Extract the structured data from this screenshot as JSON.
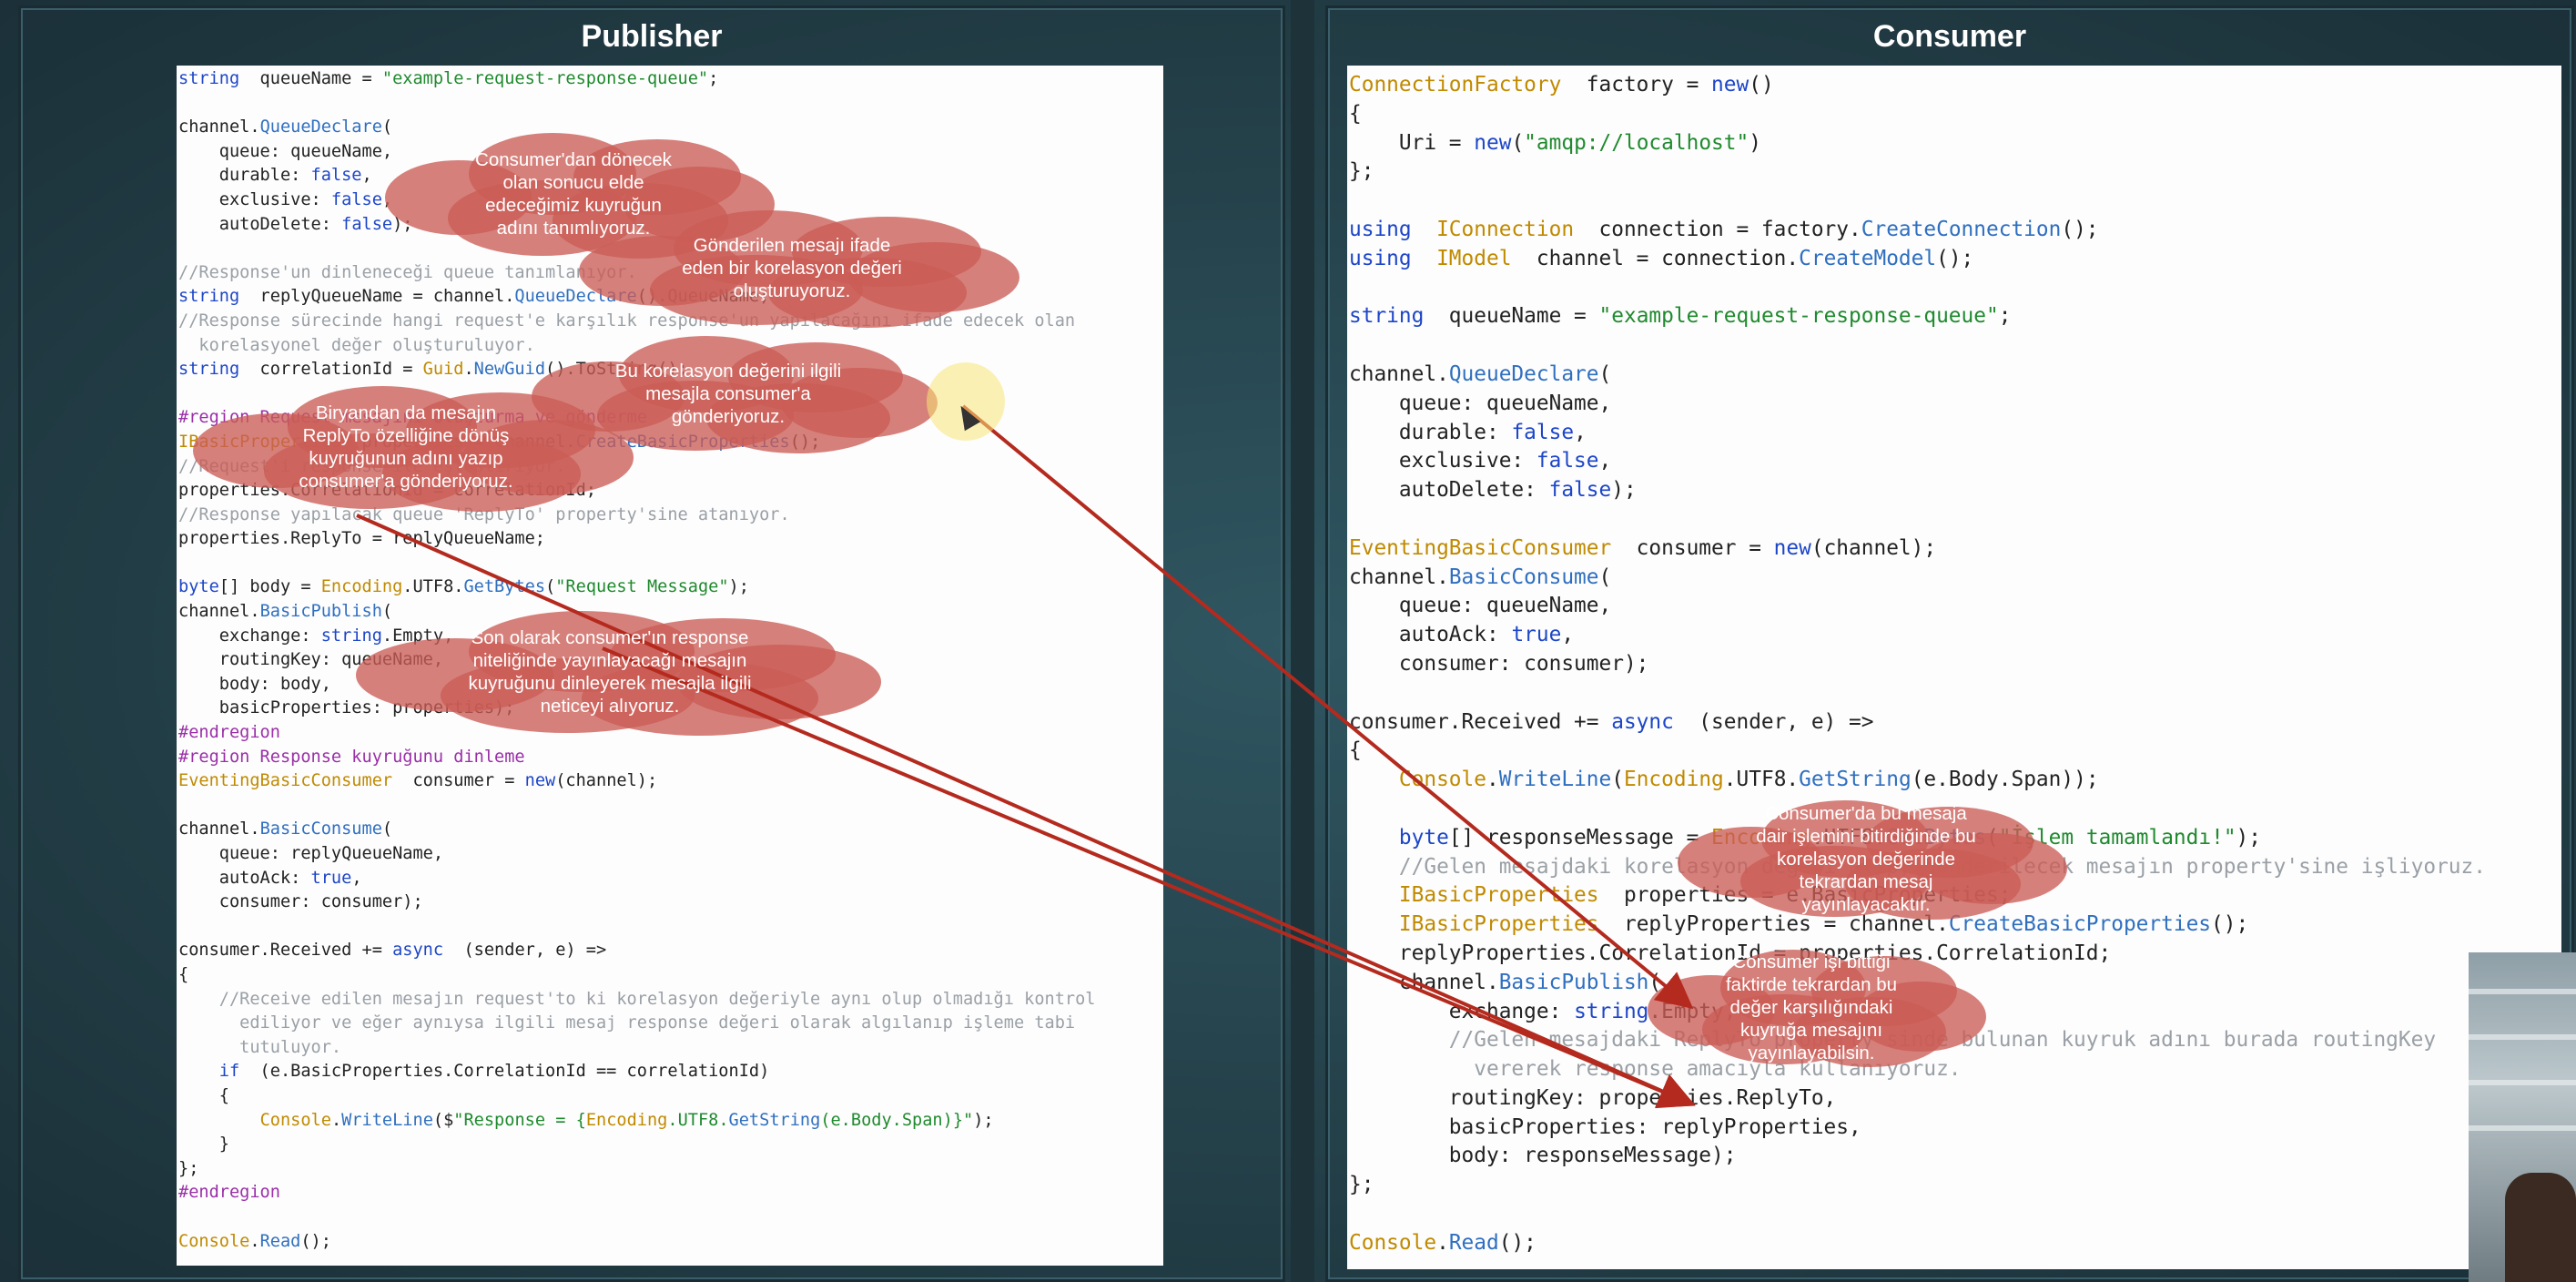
{
  "titles": {
    "publisher": "Publisher",
    "consumer": "Consumer"
  },
  "publisher_code": [
    [
      [
        "kw",
        "string"
      ],
      [
        "",
        "  queueName = "
      ],
      [
        "st",
        "\"example-request-response-queue\""
      ],
      [
        "",
        ";"
      ]
    ],
    [],
    [
      [
        "",
        "channel."
      ],
      [
        "mt",
        "QueueDeclare"
      ],
      [
        "",
        "("
      ]
    ],
    [
      [
        "",
        "    queue: queueName,"
      ]
    ],
    [
      [
        "",
        "    durable: "
      ],
      [
        "kw",
        "false"
      ],
      [
        "",
        ","
      ]
    ],
    [
      [
        "",
        "    exclusive: "
      ],
      [
        "kw",
        "false"
      ],
      [
        "",
        ","
      ]
    ],
    [
      [
        "",
        "    autoDelete: "
      ],
      [
        "kw",
        "false"
      ],
      [
        "",
        ");"
      ]
    ],
    [],
    [
      [
        "cm",
        "//Response'un dinleneceği queue tanımlanıyor."
      ]
    ],
    [
      [
        "kw",
        "string"
      ],
      [
        "",
        ""
      ],
      [
        "",
        "  replyQueueName = channel."
      ],
      [
        "mt",
        "QueueDeclare"
      ],
      [
        "",
        "().QueueName;"
      ]
    ],
    [
      [
        "cm",
        "//Response sürecinde hangi request'e karşılık response'un yapılacağını ifade edecek olan"
      ]
    ],
    [
      [
        "cm",
        "  korelasyonel değer oluşturuluyor."
      ]
    ],
    [
      [
        "kw",
        "string"
      ],
      [
        "",
        "  correlationId = "
      ],
      [
        "ty",
        "Guid"
      ],
      [
        "",
        "."
      ],
      [
        "mt",
        "NewGuid"
      ],
      [
        "",
        "().ToString();"
      ]
    ],
    [],
    [
      [
        "rg",
        "#region Request mesajını oluşturma ve gönderme"
      ]
    ],
    [
      [
        "ty",
        "IBasicProperties"
      ],
      [
        "",
        "  properties = channel."
      ],
      [
        "mt",
        "CreateBasicProperties"
      ],
      [
        "",
        "();"
      ]
    ],
    [
      [
        "cm",
        "//Request'i response ile eşleştiriyor."
      ]
    ],
    [
      [
        "",
        "properties.CorrelationId = correlationId;"
      ]
    ],
    [
      [
        "cm",
        "//Response yapılacak queue 'ReplyTo' property'sine atanıyor."
      ]
    ],
    [
      [
        "",
        "properties.ReplyTo = replyQueueName;"
      ]
    ],
    [],
    [
      [
        "kw",
        "byte"
      ],
      [
        "",
        "[] body = "
      ],
      [
        "ty",
        "Encoding"
      ],
      [
        "",
        ".UTF8."
      ],
      [
        "mt",
        "GetBytes"
      ],
      [
        "",
        "("
      ],
      [
        "st",
        "\"Request Message\""
      ],
      [
        "",
        ");"
      ]
    ],
    [
      [
        "",
        "channel."
      ],
      [
        "mt",
        "BasicPublish"
      ],
      [
        "",
        "("
      ]
    ],
    [
      [
        "",
        "    exchange: "
      ],
      [
        "kw",
        "string"
      ],
      [
        "",
        ".Empty,"
      ]
    ],
    [
      [
        "",
        "    routingKey: queueName,"
      ]
    ],
    [
      [
        "",
        "    body: body,"
      ]
    ],
    [
      [
        "",
        "    basicProperties: properties);"
      ]
    ],
    [
      [
        "rg",
        "#endregion"
      ]
    ],
    [
      [
        "rg",
        "#region Response kuyruğunu dinleme"
      ]
    ],
    [
      [
        "ty",
        "EventingBasicConsumer"
      ],
      [
        "",
        "  consumer = "
      ],
      [
        "kw",
        "new"
      ],
      [
        "",
        "(channel);"
      ]
    ],
    [],
    [
      [
        "",
        "channel."
      ],
      [
        "mt",
        "BasicConsume"
      ],
      [
        "",
        "("
      ]
    ],
    [
      [
        "",
        "    queue: replyQueueName,"
      ]
    ],
    [
      [
        "",
        "    autoAck: "
      ],
      [
        "kw",
        "true"
      ],
      [
        "",
        ","
      ]
    ],
    [
      [
        "",
        "    consumer: consumer);"
      ]
    ],
    [],
    [
      [
        "",
        "consumer.Received += "
      ],
      [
        "kw",
        "async"
      ],
      [
        "",
        "  (sender, e) =>"
      ]
    ],
    [
      [
        "",
        "{"
      ]
    ],
    [
      [
        "cm",
        "    //Receive edilen mesajın request'to ki korelasyon değeriyle aynı olup olmadığı kontrol"
      ]
    ],
    [
      [
        "cm",
        "      ediliyor ve eğer aynıysa ilgili mesaj response değeri olarak algılanıp işleme tabi"
      ]
    ],
    [
      [
        "cm",
        "      tutuluyor."
      ]
    ],
    [
      [
        "",
        "    "
      ],
      [
        "kw",
        "if"
      ],
      [
        "",
        "  (e.BasicProperties.CorrelationId == correlationId)"
      ]
    ],
    [
      [
        "",
        "    {"
      ]
    ],
    [
      [
        "",
        "        "
      ],
      [
        "ty",
        "Console"
      ],
      [
        "",
        "."
      ],
      [
        "mt",
        "WriteLine"
      ],
      [
        "",
        "($"
      ],
      [
        "st",
        "\"Response = {"
      ],
      [
        "ty",
        "Encoding"
      ],
      [
        "st",
        ".UTF8."
      ],
      [
        "mt",
        "GetString"
      ],
      [
        "st",
        "(e.Body.Span)}\""
      ],
      [
        "",
        ");"
      ]
    ],
    [
      [
        "",
        "    }"
      ]
    ],
    [
      [
        "",
        "};"
      ]
    ],
    [
      [
        "rg",
        "#endregion"
      ]
    ],
    [],
    [
      [
        "ty",
        "Console"
      ],
      [
        "",
        "."
      ],
      [
        "mt",
        "Read"
      ],
      [
        "",
        "();"
      ]
    ]
  ],
  "consumer_code": [
    [
      [
        "ty",
        "ConnectionFactory"
      ],
      [
        "",
        "  factory = "
      ],
      [
        "kw",
        "new"
      ],
      [
        "",
        "()"
      ]
    ],
    [
      [
        "",
        "{"
      ]
    ],
    [
      [
        "",
        "    Uri = "
      ],
      [
        "kw",
        "new"
      ],
      [
        "",
        "("
      ],
      [
        "st",
        "\"amqp://localhost\""
      ],
      [
        "",
        ")"
      ]
    ],
    [
      [
        "",
        "};"
      ]
    ],
    [],
    [
      [
        "kw",
        "using"
      ],
      [
        "",
        "  "
      ],
      [
        "ty",
        "IConnection"
      ],
      [
        "",
        "  connection = factory."
      ],
      [
        "mt",
        "CreateConnection"
      ],
      [
        "",
        "();"
      ]
    ],
    [
      [
        "kw",
        "using"
      ],
      [
        "",
        "  "
      ],
      [
        "ty",
        "IModel"
      ],
      [
        "",
        "  channel = connection."
      ],
      [
        "mt",
        "CreateModel"
      ],
      [
        "",
        "();"
      ]
    ],
    [],
    [
      [
        "kw",
        "string"
      ],
      [
        "",
        "  queueName = "
      ],
      [
        "st",
        "\"example-request-response-queue\""
      ],
      [
        "",
        ";"
      ]
    ],
    [],
    [
      [
        "",
        "channel."
      ],
      [
        "mt",
        "QueueDeclare"
      ],
      [
        "",
        "("
      ]
    ],
    [
      [
        "",
        "    queue: queueName,"
      ]
    ],
    [
      [
        "",
        "    durable: "
      ],
      [
        "kw",
        "false"
      ],
      [
        "",
        ","
      ]
    ],
    [
      [
        "",
        "    exclusive: "
      ],
      [
        "kw",
        "false"
      ],
      [
        "",
        ","
      ]
    ],
    [
      [
        "",
        "    autoDelete: "
      ],
      [
        "kw",
        "false"
      ],
      [
        "",
        ");"
      ]
    ],
    [],
    [
      [
        "ty",
        "EventingBasicConsumer"
      ],
      [
        "",
        "  consumer = "
      ],
      [
        "kw",
        "new"
      ],
      [
        "",
        "(channel);"
      ]
    ],
    [
      [
        "",
        "channel."
      ],
      [
        "mt",
        "BasicConsume"
      ],
      [
        "",
        "("
      ]
    ],
    [
      [
        "",
        "    queue: queueName,"
      ]
    ],
    [
      [
        "",
        "    autoAck: "
      ],
      [
        "kw",
        "true"
      ],
      [
        "",
        ","
      ]
    ],
    [
      [
        "",
        "    consumer: consumer);"
      ]
    ],
    [],
    [
      [
        "",
        "consumer.Received += "
      ],
      [
        "kw",
        "async"
      ],
      [
        "",
        "  (sender, e) =>"
      ]
    ],
    [
      [
        "",
        "{"
      ]
    ],
    [
      [
        "",
        "    "
      ],
      [
        "ty",
        "Console"
      ],
      [
        "",
        "."
      ],
      [
        "mt",
        "WriteLine"
      ],
      [
        "",
        "("
      ],
      [
        "ty",
        "Encoding"
      ],
      [
        "",
        ".UTF8."
      ],
      [
        "mt",
        "GetString"
      ],
      [
        "",
        "(e.Body.Span));"
      ]
    ],
    [],
    [
      [
        "",
        "    "
      ],
      [
        "kw",
        "byte"
      ],
      [
        "",
        "[] responseMessage = "
      ],
      [
        "ty",
        "Encoding"
      ],
      [
        "",
        ".UTF8."
      ],
      [
        "mt",
        "GetBytes"
      ],
      [
        "",
        "("
      ],
      [
        "st",
        "\"İşlem tamamlandı!\""
      ],
      [
        "",
        ");"
      ]
    ],
    [
      [
        "cm",
        "    //Gelen mesajdaki korelasyon değeri alıp, gönderilecek mesajın property'sine işliyoruz."
      ]
    ],
    [
      [
        "",
        "    "
      ],
      [
        "ty",
        "IBasicProperties"
      ],
      [
        "",
        "  properties = e.BasicProperties;"
      ]
    ],
    [
      [
        "",
        "    "
      ],
      [
        "ty",
        "IBasicProperties"
      ],
      [
        "",
        "  replyProperties = channel."
      ],
      [
        "mt",
        "CreateBasicProperties"
      ],
      [
        "",
        "();"
      ]
    ],
    [
      [
        "",
        "    replyProperties.CorrelationId = properties.CorrelationId;"
      ]
    ],
    [
      [
        "",
        "    channel."
      ],
      [
        "mt",
        "BasicPublish"
      ],
      [
        "",
        "("
      ]
    ],
    [
      [
        "",
        "        exchange: "
      ],
      [
        "kw",
        "string"
      ],
      [
        "",
        ".Empty,"
      ]
    ],
    [
      [
        "cm",
        "        //Gelen mesajdaki ReplyTo property'sinde bulunan kuyruk adını burada routingKey"
      ]
    ],
    [
      [
        "cm",
        "          vererek response amacıyla kullanıyoruz."
      ]
    ],
    [
      [
        "",
        "        routingKey: properties.ReplyTo,"
      ]
    ],
    [
      [
        "",
        "        basicProperties: replyProperties,"
      ]
    ],
    [
      [
        "",
        "        body: responseMessage);"
      ]
    ],
    [
      [
        "",
        "};"
      ]
    ],
    [],
    [
      [
        "ty",
        "Console"
      ],
      [
        "",
        "."
      ],
      [
        "mt",
        "Read"
      ],
      [
        "",
        "();"
      ]
    ]
  ],
  "notes": {
    "n1": "Consumer'dan dönecek\nolan sonucu elde\nedeceğimiz kuyruğun\nadını tanımlıyoruz.",
    "n2": "Gönderilen mesajı ifade\neden bir korelasyon değeri\noluşturuyoruz.",
    "n3": "Bu korelasyon değerini ilgili\nmesajla consumer'a\ngönderiyoruz.",
    "n4": "Biryandan da mesajın\nReplyTo özelliğine dönüş\nkuyruğunun adını yazıp\nconsumer'a gönderiyoruz.",
    "n5": "Son olarak consumer'ın response\nniteliğinde yayınlayacağı mesajın\nkuyruğunu dinleyerek mesajla ilgili\nneticeyi alıyoruz.",
    "n6": "Consumer'da bu mesaja\ndair işlemini bitirdiğinde bu\nkorelasyon değerinde\ntekrardan mesaj\nyayınlayacaktır.",
    "n7": "Consumer işi bittiği\nfaktirde tekrardan bu\ndeğer karşılığındaki\nkuyruğa mesajını\nyayınlayabilsin."
  },
  "colors": {
    "cloud": "#ca5c56",
    "arrow": "#b42a1e",
    "background": "#27454f"
  }
}
